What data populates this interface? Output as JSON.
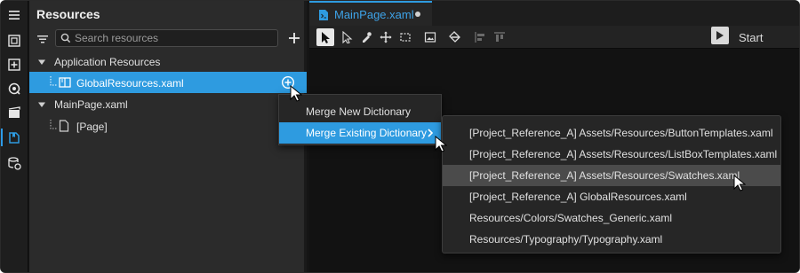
{
  "left_toolbar": {
    "icons": [
      "menu-icon",
      "assets-icon",
      "add-icon",
      "properties-icon",
      "media-icon",
      "resources-icon",
      "data-icon"
    ]
  },
  "panel": {
    "title": "Resources",
    "search_placeholder": "Search resources",
    "tree": {
      "application_resources": "Application Resources",
      "global_resources": "GlobalResources.xaml",
      "mainpage": "MainPage.xaml",
      "page": "[Page]"
    }
  },
  "document": {
    "tab_label": "MainPage.xaml",
    "start_label": "Start"
  },
  "context_menu": {
    "items": [
      "Merge New Dictionary",
      "Merge Existing Dictionary"
    ]
  },
  "submenu": {
    "items": [
      "[Project_Reference_A] Assets/Resources/ButtonTemplates.xaml",
      "[Project_Reference_A] Assets/Resources/ListBoxTemplates.xaml",
      "[Project_Reference_A] Assets/Resources/Swatches.xaml",
      "[Project_Reference_A] GlobalResources.xaml",
      "Resources/Colors/Swatches_Generic.xaml",
      "Resources/Typography/Typography.xaml"
    ]
  },
  "colors": {
    "accent": "#2e9be0",
    "panel_bg": "#2b2b2b",
    "canvas_bg": "#121212"
  }
}
